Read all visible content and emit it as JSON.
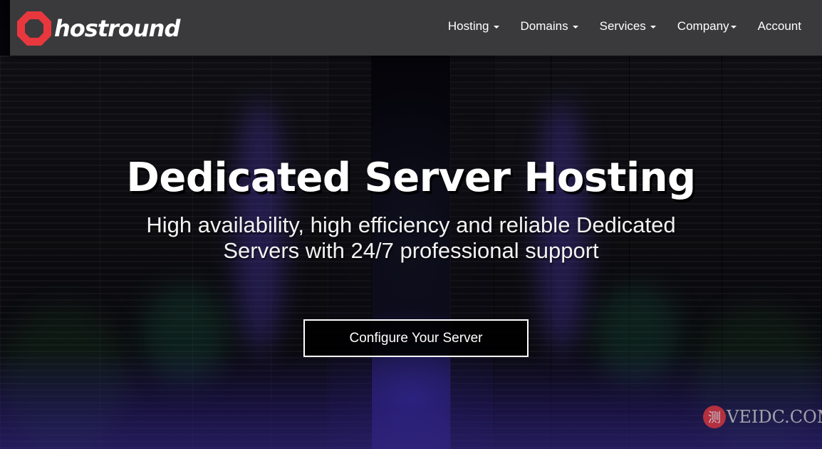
{
  "brand": {
    "name": "hostround",
    "logo_color": "#e8383d"
  },
  "nav": {
    "items": [
      {
        "label": "Hosting",
        "has_dropdown": true
      },
      {
        "label": "Domains",
        "has_dropdown": true
      },
      {
        "label": "Services",
        "has_dropdown": true
      },
      {
        "label": "Company",
        "has_dropdown": true
      },
      {
        "label": "Account",
        "has_dropdown": false
      }
    ]
  },
  "hero": {
    "title": "Dedicated Server Hosting",
    "subtitle": "High availability, high efficiency and reliable Dedicated Servers with 24/7 professional support",
    "cta_label": "Configure Your Server"
  },
  "watermark": {
    "text": "VEIDC.COM",
    "seal_glyph": "测"
  },
  "colors": {
    "header_bg": "#3a3a3c",
    "text": "#ffffff",
    "accent_red": "#e8383d"
  }
}
